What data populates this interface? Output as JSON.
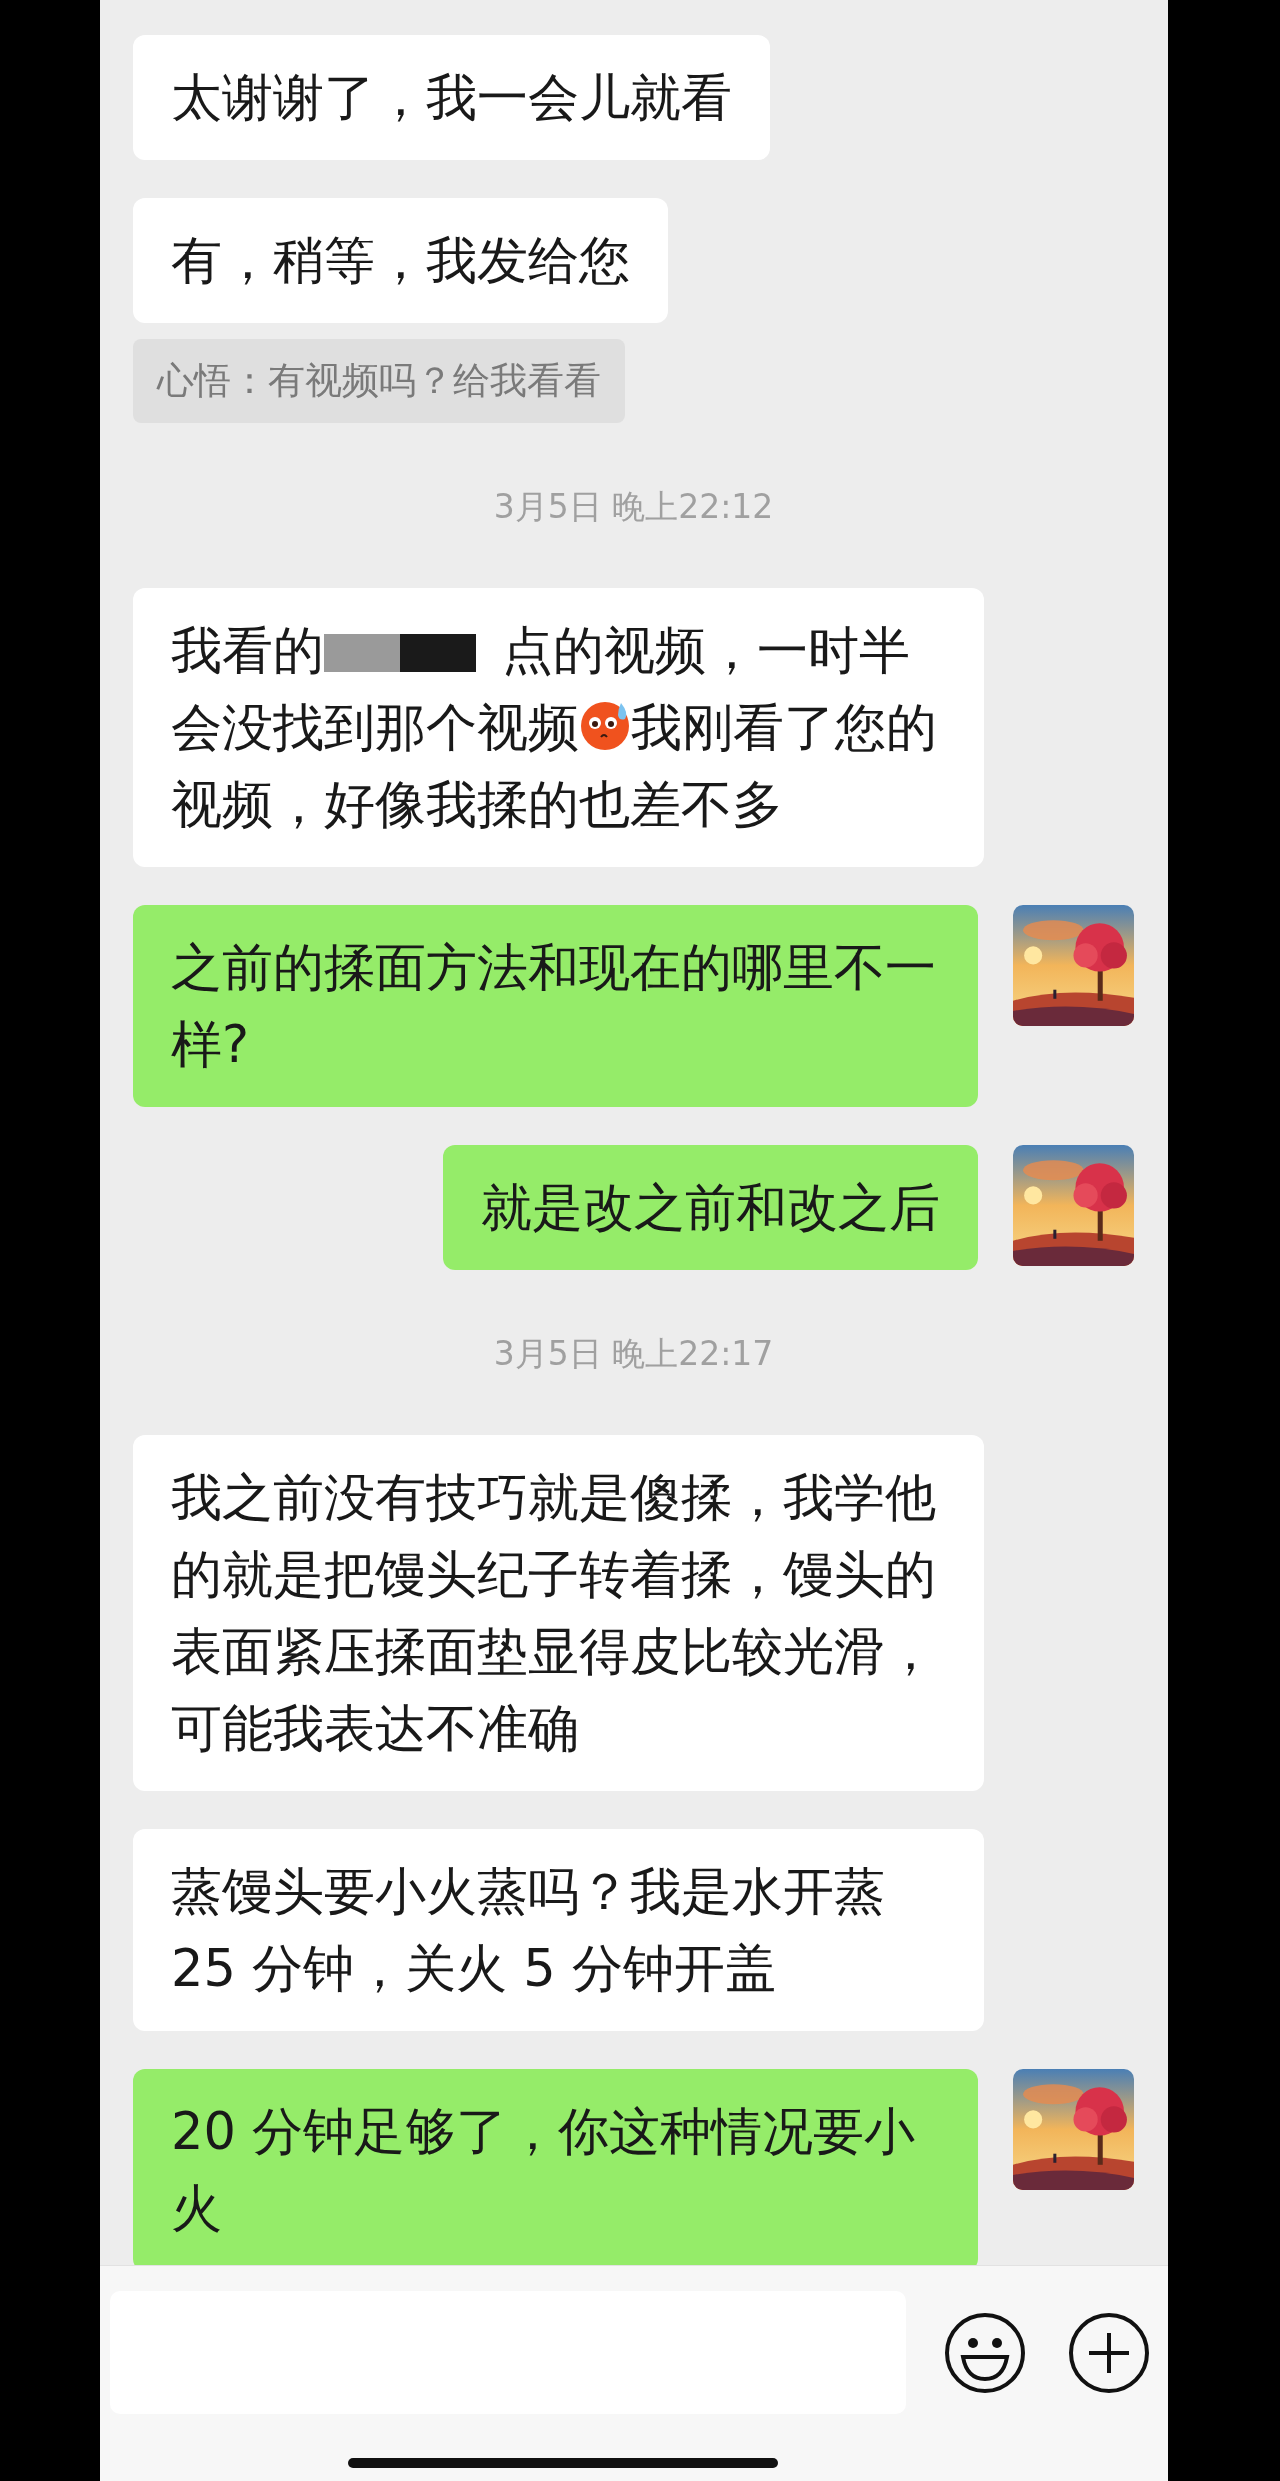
{
  "messages": [
    {
      "kind": "received",
      "text": "太谢谢了，我一会儿就看"
    },
    {
      "kind": "received",
      "text": "有，稍等，我发给您",
      "quote": "心悟：有视频吗？给我看看"
    },
    {
      "kind": "time",
      "text": "3月5日 晚上22:12"
    },
    {
      "kind": "received",
      "segments": [
        {
          "kind": "text",
          "text": "我看的"
        },
        {
          "kind": "redaction"
        },
        {
          "kind": "text",
          "text": "点的视频，一时半会没找到那个视频"
        },
        {
          "kind": "emoji"
        },
        {
          "kind": "text",
          "text": "我刚看了您的视频，好像我揉的也差不多"
        }
      ]
    },
    {
      "kind": "sent",
      "text": "之前的揉面方法和现在的哪里不一样?"
    },
    {
      "kind": "sent",
      "text": "就是改之前和改之后"
    },
    {
      "kind": "time",
      "text": "3月5日 晚上22:17"
    },
    {
      "kind": "received",
      "text": "我之前没有技巧就是傻揉，我学他的就是把馒头纪子转着揉，馒头的表面紧压揉面垫显得皮比较光滑，可能我表达不准确"
    },
    {
      "kind": "received",
      "text": "蒸馒头要小火蒸吗？我是水开蒸25 分钟，关火 5 分钟开盖"
    },
    {
      "kind": "sent",
      "text": "20 分钟足够了，你这种情况要小火"
    }
  ]
}
